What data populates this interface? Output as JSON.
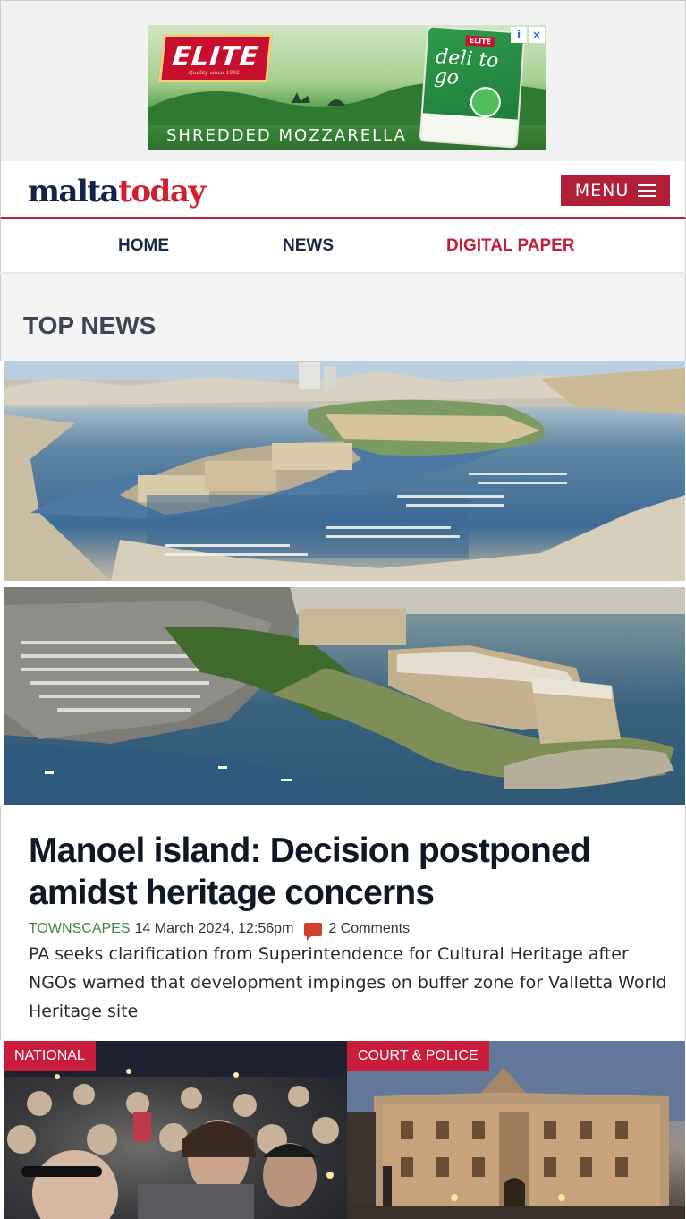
{
  "ad": {
    "brand": "ELITE",
    "brand_sub": "Quality since 1992",
    "product_brand": "ELITE",
    "product_name": "deli to go",
    "tagline": "SHREDDED MOZZARELLA",
    "info_icon": "i",
    "close_icon": "×"
  },
  "header": {
    "logo_part1": "malta",
    "logo_part2": "today",
    "menu_label": "MENU"
  },
  "nav": {
    "items": [
      {
        "label": "HOME"
      },
      {
        "label": "NEWS"
      },
      {
        "label": "DIGITAL PAPER"
      }
    ]
  },
  "main": {
    "section_title": "TOP NEWS",
    "article": {
      "headline": "Manoel island: Decision postponed amidst heritage concerns",
      "category": "TOWNSCAPES",
      "date": "14 March 2024, 12:56pm",
      "comments": "2 Comments",
      "summary": "PA seeks clarification from Superintendence for Cultural Heritage after NGOs warned that development impinges on buffer zone for Valletta World Heritage site"
    },
    "cards": [
      {
        "tag": "NATIONAL"
      },
      {
        "tag": "COURT & POLICE"
      }
    ]
  },
  "colors": {
    "brand_red": "#c0203c",
    "navy": "#15234a",
    "category_green": "#3d8a3d"
  }
}
